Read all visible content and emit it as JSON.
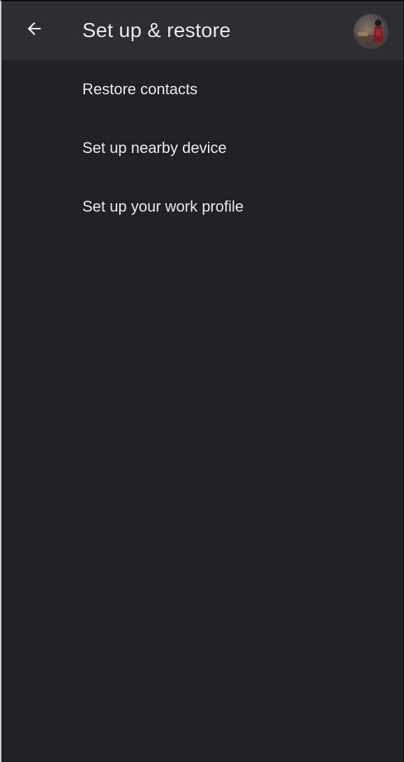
{
  "header": {
    "back_icon": "arrow-back-icon",
    "title": "Set up & restore",
    "avatar_icon": "account-avatar"
  },
  "menu": {
    "items": [
      {
        "label": "Restore contacts"
      },
      {
        "label": "Set up nearby device"
      },
      {
        "label": "Set up your work profile"
      }
    ]
  },
  "colors": {
    "background": "#202124",
    "app_bar": "#2d2e31",
    "text": "#e8eaed"
  }
}
